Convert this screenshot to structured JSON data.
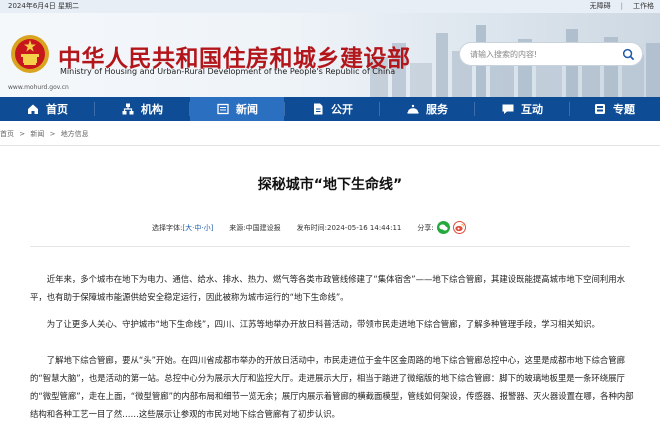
{
  "topbar": {
    "date": "2024年6月4日 星期二",
    "accessibility": "无障碍",
    "separator": "|",
    "english": "工作格"
  },
  "header": {
    "title_cn": "中华人民共和国住房和城乡建设部",
    "title_en": "Ministry of Housing and Urban-Rural Development of the People's Republic of China",
    "site_url": "www.mohurd.gov.cn",
    "search_placeholder": "请输入搜索的内容!"
  },
  "nav": {
    "items": [
      {
        "label": "首页",
        "icon": "home-icon"
      },
      {
        "label": "机构",
        "icon": "org-icon"
      },
      {
        "label": "新闻",
        "icon": "news-icon",
        "active": true
      },
      {
        "label": "公开",
        "icon": "document-icon"
      },
      {
        "label": "服务",
        "icon": "service-icon"
      },
      {
        "label": "互动",
        "icon": "chat-icon"
      },
      {
        "label": "专题",
        "icon": "topic-icon"
      }
    ]
  },
  "breadcrumb": [
    "首页",
    ">",
    "新闻",
    ">",
    "地方信息"
  ],
  "article": {
    "title": "探秘城市“地下生命线”",
    "font_label": "选择字体:",
    "font_open": "[",
    "font_sizes": [
      "大",
      "中",
      "小"
    ],
    "font_dot": "·",
    "font_close": "]",
    "source_label": "来源:",
    "source": "中国建设报",
    "published_label": "发布时间:",
    "published": "2024-05-16 14:44:11",
    "share_label": "分享:",
    "share_icons": [
      "wechat-icon",
      "weibo-icon"
    ],
    "paragraphs": [
      "近年来，多个城市在地下为电力、通信、给水、排水、热力、燃气等各类市政管线修建了“集体宿舍”——地下综合管廊，其建设既能提高城市地下空间利用水平，也有助于保障城市能源供给安全稳定运行，因此被称为城市运行的“地下生命线”。",
      "为了让更多人关心、守护城市“地下生命线”，四川、江苏等地举办开放日科普活动，带领市民走进地下综合管廊，了解多种管理手段，学习相关知识。",
      "了解地下综合管廊，要从“头”开始。在四川省成都市举办的开放日活动中，市民走进位于金牛区金周路的地下综合管廊总控中心，这里是成都市地下综合管廊的“智慧大脑”，也是活动的第一站。总控中心分为展示大厅和监控大厅。走进展示大厅，相当于踏进了微缩版的地下综合管廊：脚下的玻璃地板里是一条环绕展厅的“微型管廊”，走在上面，“微型管廊”的内部布局和细节一览无余；展厅内展示着管廊的横截面模型，管线如何架设，传感器、报警器、灭火器设置在哪，各种内部结构和各种工艺一目了然……这些展示让参观的市民对地下综合管廊有了初步认识。"
    ]
  },
  "colors": {
    "brand_red": "#b3161a",
    "nav_blue": "#0e4c96",
    "nav_active": "#2a6fc0",
    "link_blue": "#1b5fad"
  }
}
